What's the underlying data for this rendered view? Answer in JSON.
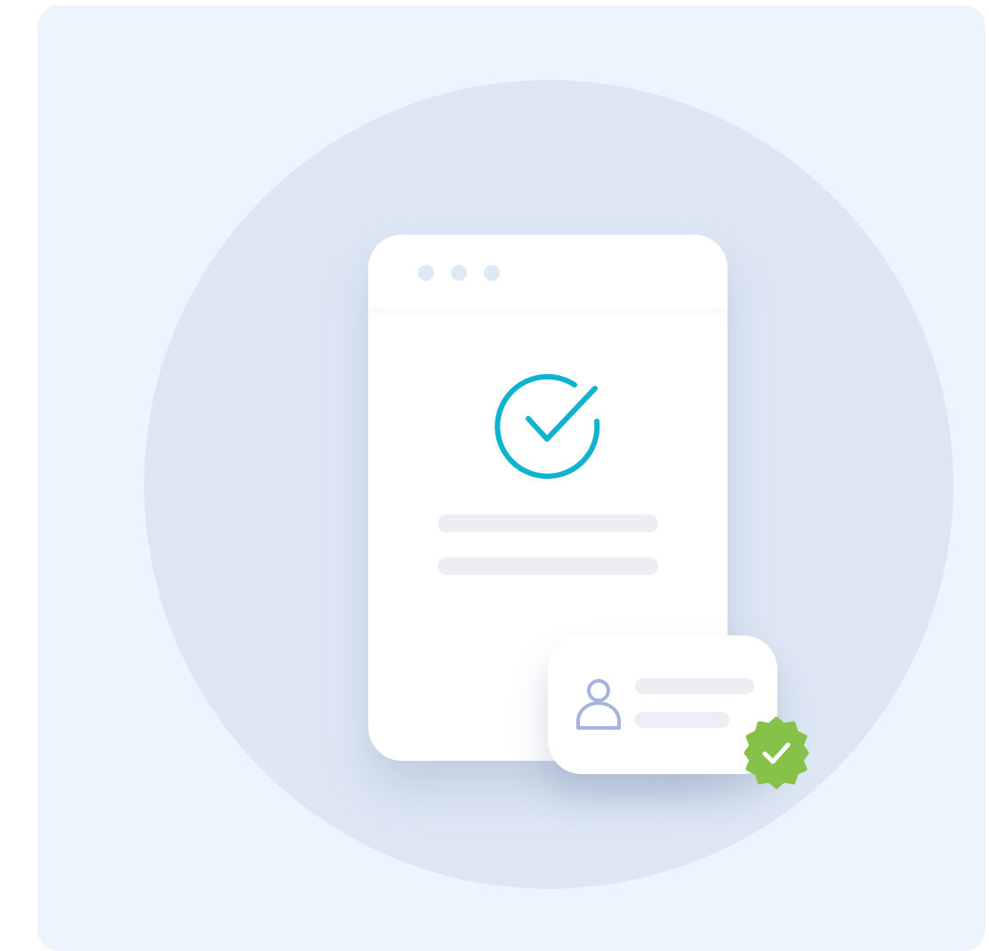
{
  "icons": {
    "success": "check-circle-icon",
    "user": "user-icon",
    "verified": "verified-badge-icon"
  },
  "colors": {
    "background": "#edf4fd",
    "halo": "#dde7f4",
    "accent": "#0fb3cf",
    "verified": "#86c24a",
    "user_icon": "#a4b4dc",
    "placeholder": "#eceef3"
  }
}
